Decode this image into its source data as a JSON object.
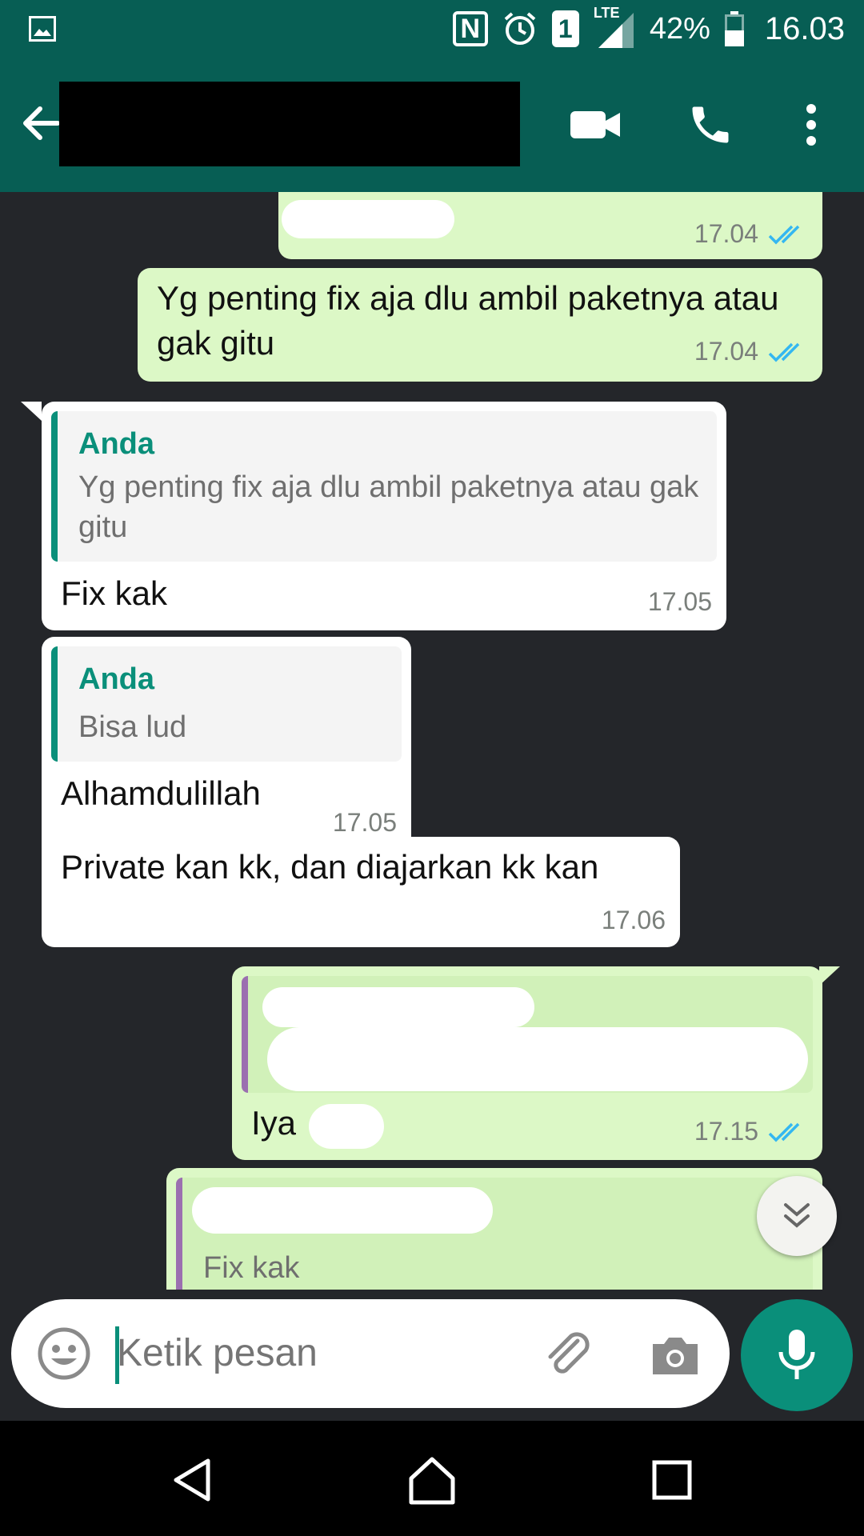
{
  "status_bar": {
    "nfc_label": "N",
    "sim_slot": "1",
    "network": "LTE",
    "battery_percent": "42%",
    "battery_level": 0.42,
    "time": "16.03"
  },
  "toolbar": {
    "contact_name_redacted": true,
    "icons": [
      "back-arrow-icon",
      "video-call-icon",
      "phone-icon",
      "more-vertical-icon"
    ]
  },
  "messages": [
    {
      "id": "m0",
      "direction": "outgoing",
      "text": "",
      "time": "17.04",
      "read": true
    },
    {
      "id": "m1",
      "direction": "outgoing",
      "text": "Yg penting fix aja dlu ambil paketnya atau gak gitu",
      "time": "17.04",
      "read": true
    },
    {
      "id": "m2",
      "direction": "incoming",
      "quote_author": "Anda",
      "quote_text": "Yg penting fix aja dlu ambil paketnya atau gak gitu",
      "text": "Fix kak",
      "time": "17.05"
    },
    {
      "id": "m3",
      "direction": "incoming",
      "quote_author": "Anda",
      "quote_text": "Bisa lud",
      "text": "Alhamdulillah",
      "time": "17.05"
    },
    {
      "id": "m4",
      "direction": "incoming",
      "text": "Private kan kk, dan diajarkan kk kan",
      "time": "17.06"
    },
    {
      "id": "m5",
      "direction": "outgoing",
      "quote_author": "",
      "quote_text": "",
      "text": "Iya",
      "time": "17.15",
      "read": true
    },
    {
      "id": "m6",
      "direction": "outgoing",
      "quote_author": "",
      "quote_text": "Fix kak",
      "text": "",
      "time": ""
    }
  ],
  "input": {
    "placeholder": "Ketik pesan"
  },
  "colors": {
    "header": "#075e54",
    "accent": "#0a8f7a",
    "outgoing_bubble": "#dcf8c6",
    "incoming_bubble": "#ffffff",
    "chat_background": "#24262a",
    "read_ticks": "#34b7f1"
  }
}
